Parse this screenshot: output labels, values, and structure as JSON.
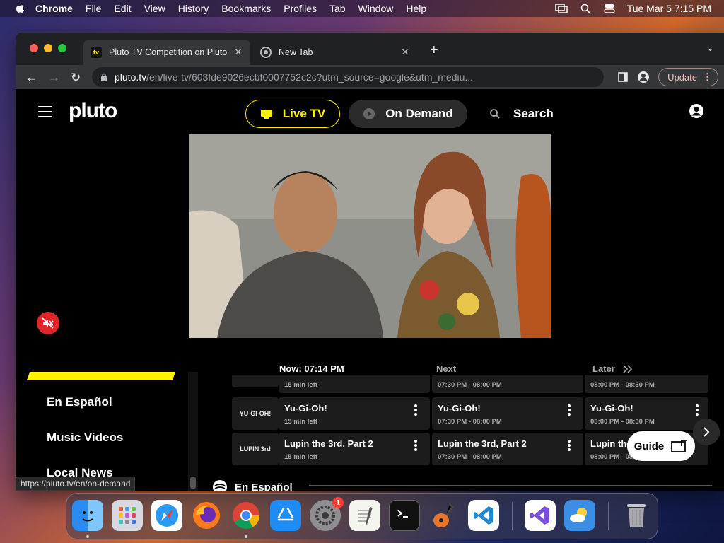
{
  "menubar": {
    "app": "Chrome",
    "items": [
      "File",
      "Edit",
      "View",
      "History",
      "Bookmarks",
      "Profiles",
      "Tab",
      "Window",
      "Help"
    ],
    "clock": "Tue Mar 5  7:15 PM"
  },
  "browser": {
    "tabs": [
      {
        "title": "Pluto TV Competition on Pluto",
        "favicon_text": "tv"
      },
      {
        "title": "New Tab"
      }
    ],
    "url_host": "pluto.tv",
    "url_rest": "/en/live-tv/603fde9026ecbf0007752c2c?utm_source=google&utm_mediu...",
    "update_label": "Update",
    "status_url": "https://pluto.tv/en/on-demand"
  },
  "pluto": {
    "logo": "pluto",
    "nav": {
      "live": "Live TV",
      "ondemand": "On Demand",
      "search": "Search"
    },
    "categories": [
      "En Español",
      "Music Videos",
      "Local News"
    ],
    "guide": {
      "now": "Now: 07:14 PM",
      "next": "Next",
      "later": "Later",
      "top_row": {
        "now": "15 min left",
        "next": "07:30 PM - 08:00 PM",
        "later": "08:00 PM - 08:30 PM"
      },
      "rows": [
        {
          "channel_logo": "YU-GI-OH!",
          "now_title": "Yu-Gi-Oh!",
          "now_sub": "15 min left",
          "next_title": "Yu-Gi-Oh!",
          "next_sub": "07:30 PM - 08:00 PM",
          "later_title": "Yu-Gi-Oh!",
          "later_sub": "08:00 PM - 08:30 PM"
        },
        {
          "channel_logo": "LUPIN 3rd",
          "now_title": "Lupin the 3rd, Part 2",
          "now_sub": "15 min left",
          "next_title": "Lupin the 3rd, Part 2",
          "next_sub": "07:30 PM - 08:00 PM",
          "later_title": "Lupin the",
          "later_sub": "08:00 PM - 08:30 PM"
        }
      ],
      "guide_button": "Guide",
      "section": "En Español"
    }
  },
  "dock": {
    "badge": "1"
  }
}
